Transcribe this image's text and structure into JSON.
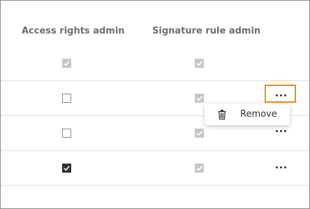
{
  "columns": {
    "access_rights_admin": "Access rights admin",
    "signature_rule_admin": "Signature rule admin"
  },
  "rows": [
    {
      "access_rights": "disabled-checked",
      "signature_rule": "disabled-checked",
      "has_actions": false
    },
    {
      "access_rights": "unchecked",
      "signature_rule": "disabled-checked",
      "has_actions": true,
      "actions_focused": true
    },
    {
      "access_rights": "unchecked",
      "signature_rule": "disabled-checked",
      "has_actions": true
    },
    {
      "access_rights": "checked",
      "signature_rule": "disabled-checked",
      "has_actions": true
    }
  ],
  "context_menu": {
    "items": [
      {
        "label": "Remove",
        "icon": "trash-icon"
      }
    ]
  },
  "colors": {
    "focus_outline": "#f28c1b",
    "disabled_check": "#c8c6c4",
    "checked": "#323130"
  }
}
